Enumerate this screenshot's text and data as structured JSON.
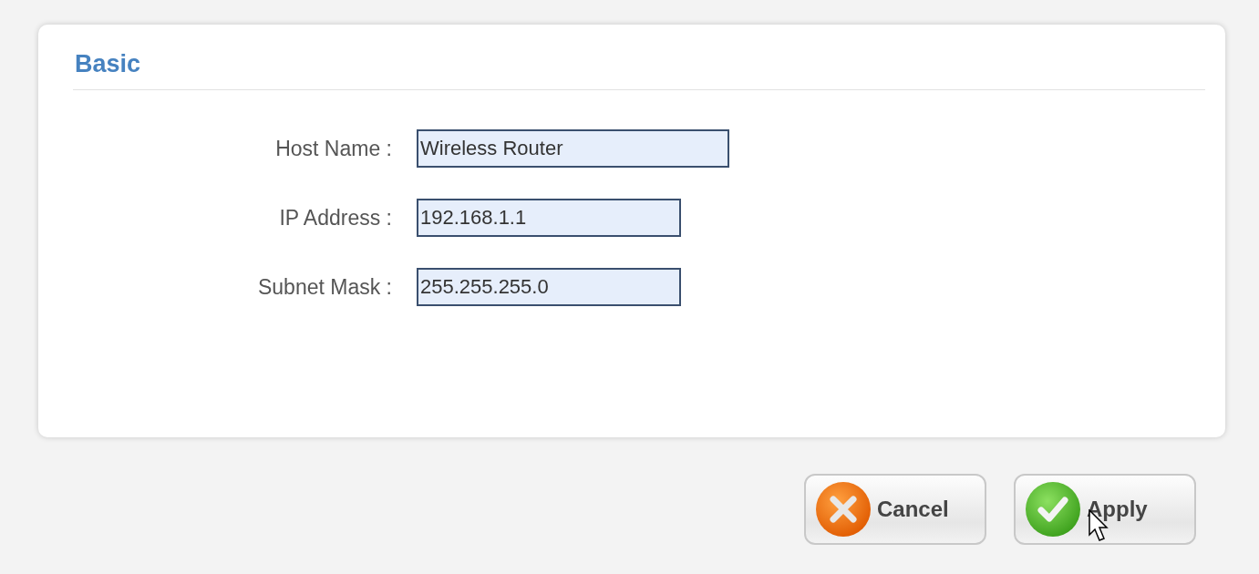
{
  "panel": {
    "title": "Basic"
  },
  "fields": [
    {
      "label": "Host Name :",
      "value": "Wireless Router"
    },
    {
      "label": "IP Address :",
      "value": "192.168.1.1"
    },
    {
      "label": "Subnet Mask :",
      "value": "255.255.255.0"
    }
  ],
  "buttons": [
    {
      "kind": "cancel",
      "label": "Cancel"
    },
    {
      "kind": "apply",
      "label": "Apply"
    }
  ]
}
